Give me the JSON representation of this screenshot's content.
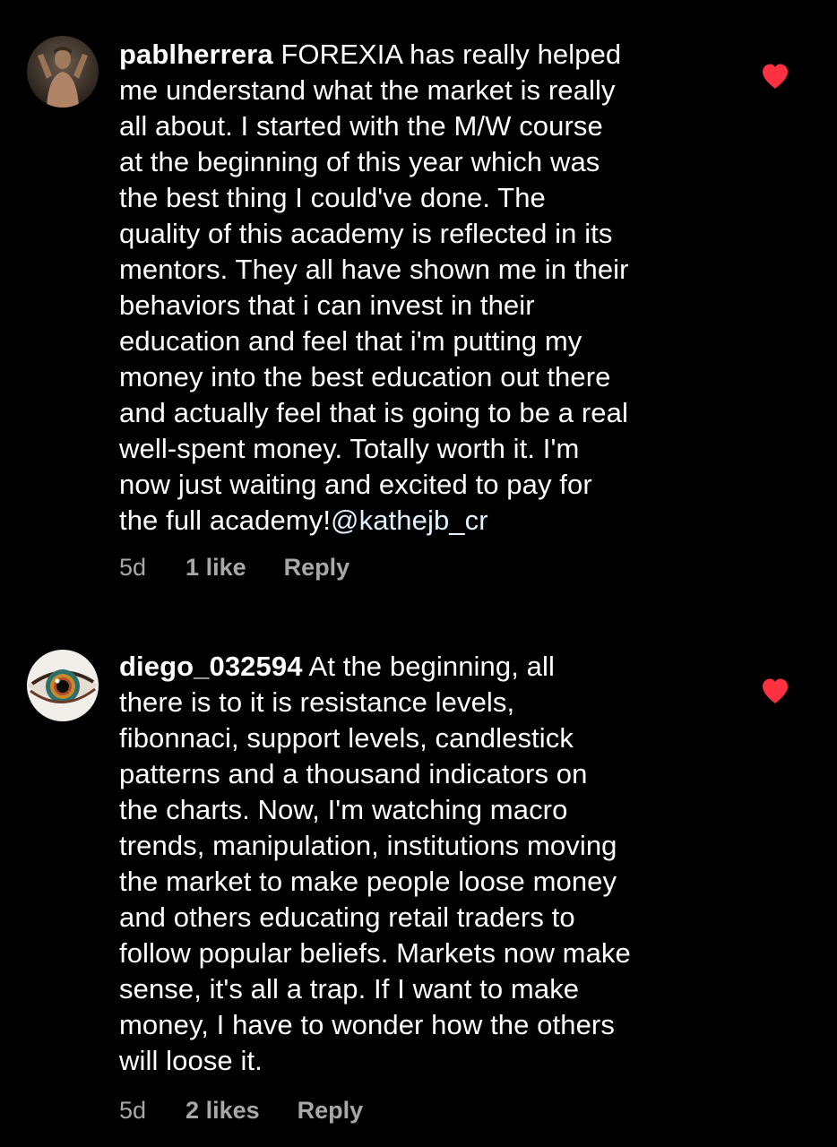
{
  "comments": [
    {
      "username": "pablherrera",
      "body": " FOREXIA has really helped\nme understand what the market is really\nall about. I started with the M/W course\nat the beginning of this year which was\nthe best thing  I could've done. The\nquality of this academy is reflected in its\nmentors. They all have shown me in their\nbehaviors that i can invest in their\neducation and feel that i'm putting my\nmoney into the best education out there\nand actually feel that is going to be a real\nwell-spent money. Totally worth it. I'm\nnow just waiting and excited to pay for\nthe full academy!",
      "mention": "@kathejb_cr",
      "time": "5d",
      "likes": "1 like",
      "reply": "Reply",
      "liked": true
    },
    {
      "username": "diego_032594",
      "body": " At the beginning, all\nthere is to it is resistance levels,\nfibonnaci, support levels, candlestick\npatterns and a thousand indicators on\nthe charts. Now, I'm watching macro\ntrends, manipulation, institutions moving\nthe market to make people loose money\nand others educating retail traders to\nfollow popular beliefs. Markets now make\nsense, it's all a trap. If I want to make\nmoney, I have to wonder how the others\nwill loose it.",
      "mention": "",
      "time": "5d",
      "likes": "2 likes",
      "reply": "Reply",
      "liked": true
    }
  ],
  "colors": {
    "background": "#000000",
    "text": "#ffffff",
    "meta": "#a8a8a8",
    "heart": "#ff3040",
    "mention": "#e0f1ff"
  },
  "icons": {
    "like": "heart-icon"
  }
}
